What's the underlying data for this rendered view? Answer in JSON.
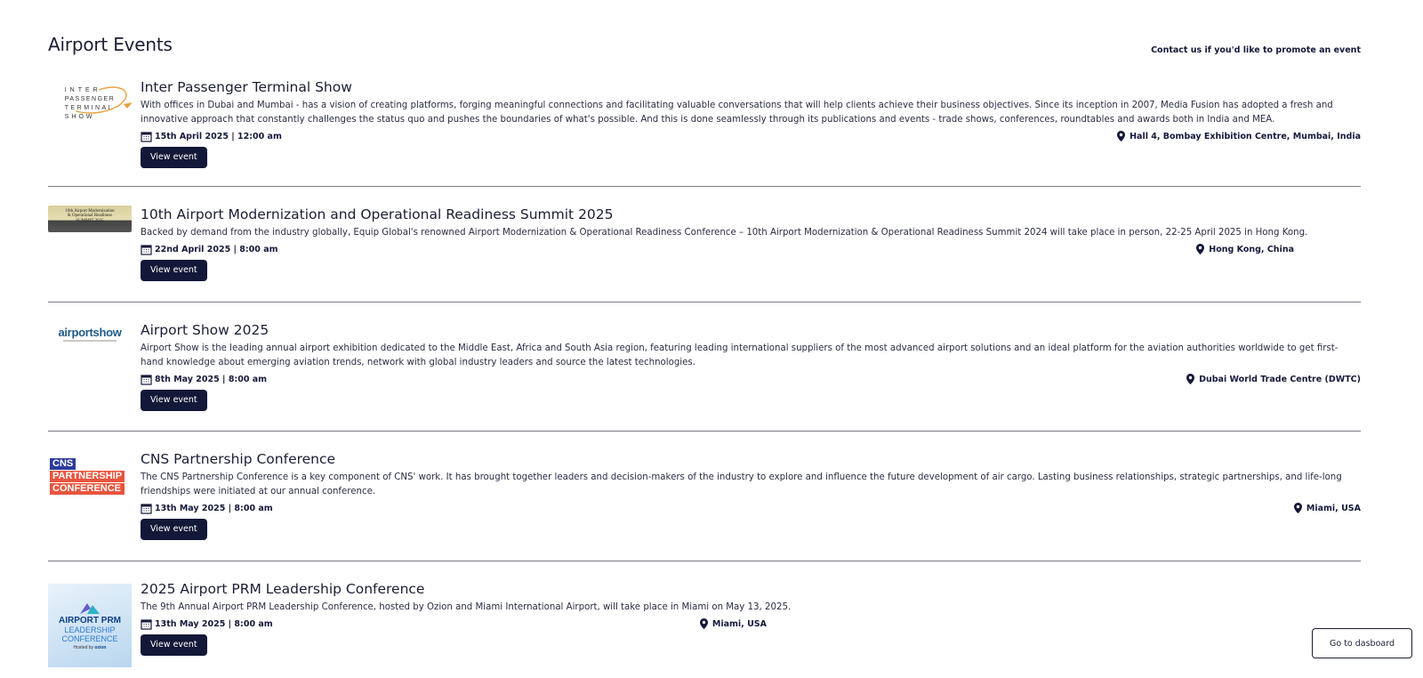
{
  "header": {
    "title": "Airport Events",
    "promote_link": "Contact us if you'd like to promote an event"
  },
  "events": [
    {
      "title": "Inter Passenger Terminal Show",
      "description": "With offices in Dubai and Mumbai - has a vision of creating platforms, forging meaningful connections and facilitating valuable conversations that will help clients achieve their business objectives. Since its inception in 2007, Media Fusion has adopted a fresh and innovative approach that constantly challenges the status quo and pushes the boundaries of what's possible. And this is done seamlessly through its publications and events - trade shows, conferences, roundtables and awards both in India and MEA.",
      "date": "15th April 2025 | 12:00 am",
      "location": "Hall 4, Bombay Exhibition Centre, Mumbai, India",
      "button": "View event",
      "logo_text": [
        "INTER",
        "PASSENGER",
        "TERMINAL",
        "SHOW"
      ]
    },
    {
      "title": "10th Airport Modernization and Operational Readiness Summit 2025",
      "description": "Backed by demand from the industry globally, Equip Global's renowned Airport Modernization & Operational Readiness Conference – 10th Airport Modernization & Operational Readiness Summit 2024 will take place in person, 22-25 April 2025 in Hong Kong.",
      "date": "22nd April 2025 | 8:00 am",
      "location": "Hong Kong, China",
      "button": "View event",
      "logo_text": [
        "10th Airport Modernization",
        "& Operational Readiness",
        "SUMMIT 2025"
      ]
    },
    {
      "title": "Airport Show 2025",
      "description": "Airport Show is the leading annual airport exhibition dedicated to the Middle East, Africa and South Asia region, featuring leading international suppliers of the most advanced airport solutions and an ideal platform for the aviation authorities worldwide to get first-hand knowledge about emerging aviation trends, network with global industry leaders and source the latest technologies.",
      "date": "8th May 2025 | 8:00 am",
      "location": "Dubai World Trade Centre (DWTC)",
      "button": "View event",
      "logo_text": [
        "airportshow"
      ]
    },
    {
      "title": "CNS Partnership Conference",
      "description": "The CNS Partnership Conference is a key component of CNS' work. It has brought together leaders and decision-makers of the industry to explore and influence the future development of air cargo. Lasting business relationships, strategic partnerships, and life-long friendships were initiated at our annual conference.",
      "date": "13th May 2025 | 8:00 am",
      "location": "Miami, USA",
      "button": "View event",
      "logo_text": [
        "CNS",
        "PARTNERSHIP",
        "CONFERENCE"
      ]
    },
    {
      "title": "2025 Airport PRM Leadership Conference",
      "description": "The 9th Annual Airport PRM Leadership Conference, hosted by Ozion and Miami International Airport, will take place in Miami on May 13, 2025.",
      "date": "13th May 2025 | 8:00 am",
      "location": "Miami, USA",
      "button": "View event",
      "logo_text": [
        "AIRPORT PRM",
        "LEADERSHIP",
        "CONFERENCE",
        "Hosted by",
        "ozion"
      ]
    }
  ],
  "dashboard_button": "Go to dasboard",
  "colors": {
    "button_bg": "#141838",
    "text_dark": "#1b1e35",
    "divider": "#7a7c86",
    "cns_blue": "#2d3b9c",
    "cns_orange": "#e8553d"
  }
}
